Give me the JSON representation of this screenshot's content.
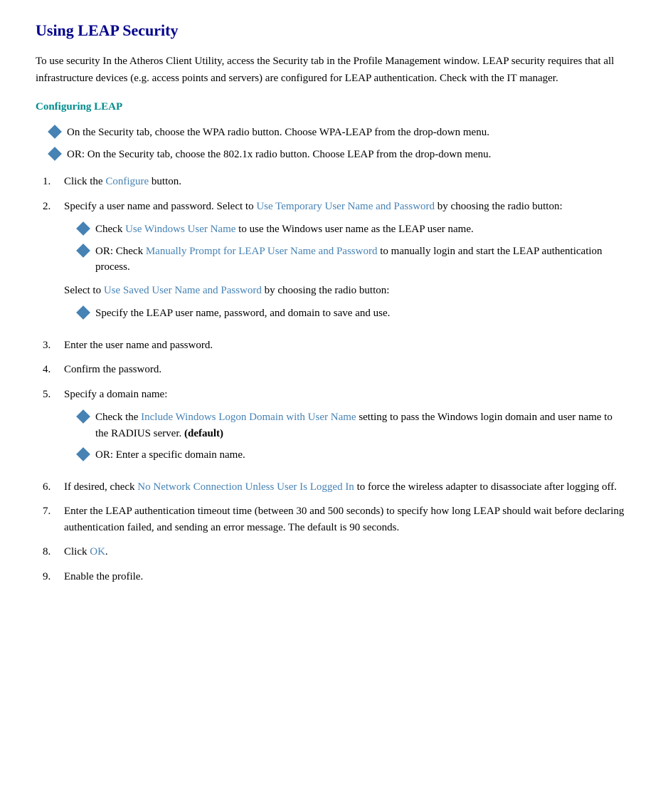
{
  "page": {
    "title": "Using LEAP Security",
    "intro": "To use security In the Atheros Client Utility, access the Security tab in the Profile Management window. LEAP security requires that all infrastructure devices (e.g. access points and servers) are configured for LEAP authentication. Check with the IT manager.",
    "section_heading": "Configuring LEAP",
    "bullet1": "On the Security tab, choose the WPA radio button. Choose WPA-LEAP from the drop-down menu.",
    "bullet2": "OR: On the Security tab, choose the 802.1x radio button. Choose LEAP from the drop-down menu.",
    "step1_pre": "Click the ",
    "step1_link": "Configure",
    "step1_post": " button.",
    "step2_pre": "Specify a user name and password.  Select to ",
    "step2_link": "Use Temporary User Name and Password",
    "step2_post": " by choosing the radio button:",
    "nested1_pre": "Check ",
    "nested1_link": "Use Windows User Name",
    "nested1_post": " to use the Windows user name as the LEAP user name.",
    "nested2_pre": "OR: Check ",
    "nested2_link": "Manually Prompt for LEAP User Name and Password",
    "nested2_post": " to manually login and start the LEAP authentication process.",
    "select_pre": "Select to ",
    "select_link": "Use Saved User Name and Password",
    "select_post": " by choosing the radio button:",
    "nested3": "Specify the LEAP user name, password, and domain to save and use.",
    "step3": "Enter the user name and password.",
    "step4": "Confirm the password.",
    "step5_pre": "Specify a domain name:",
    "nested4_pre": "Check the ",
    "nested4_link": "Include Windows Logon Domain with User Name",
    "nested4_post": " setting to pass the Windows login domain and user name to the RADIUS server. ",
    "nested4_bold": "(default)",
    "nested5": "OR: Enter a specific domain name.",
    "step6_pre": "If desired, check ",
    "step6_link": "No Network Connection Unless User Is Logged In",
    "step6_post": " to force the wireless adapter to disassociate after logging off.",
    "step7": "Enter the LEAP authentication timeout time (between 30 and 500 seconds) to specify how long LEAP should wait before declaring authentication failed, and sending an error message.  The default is 90 seconds.",
    "step8_pre": "Click ",
    "step8_link": "OK",
    "step8_post": ".",
    "step9": "Enable the profile."
  }
}
